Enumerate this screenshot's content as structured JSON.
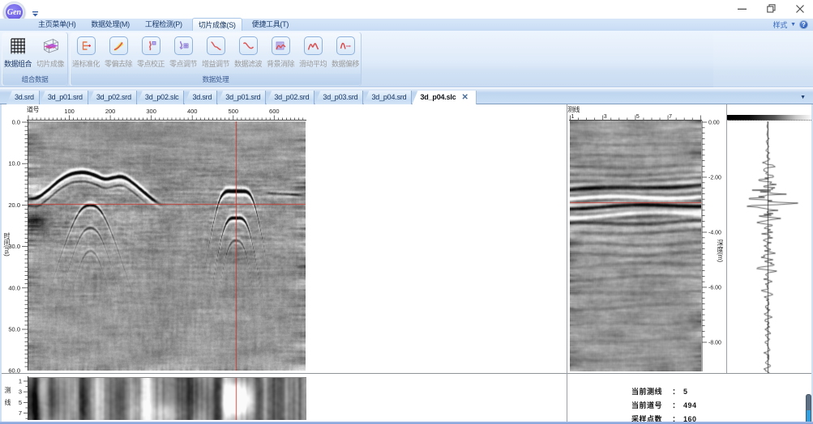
{
  "titlebar": {
    "logo_text": "Gen"
  },
  "window_buttons": {
    "minimize": "minimize",
    "restore": "restore-down",
    "close": "close"
  },
  "menu_tabs": {
    "active_index": 3,
    "items": [
      {
        "label": "主页菜单(H)"
      },
      {
        "label": "数据处理(M)"
      },
      {
        "label": "工程检测(P)"
      },
      {
        "label": "切片成像(S)"
      },
      {
        "label": "便捷工具(T)"
      }
    ]
  },
  "style_selector": {
    "label": "样式",
    "caret": "▼",
    "help_glyph": "?"
  },
  "ribbon": {
    "groups": [
      {
        "label": "组合数据",
        "buttons": [
          {
            "label": "数据组合",
            "icon": "data-combine-grid-icon",
            "enabled": true
          },
          {
            "label": "切片成像",
            "icon": "slice-imaging-cube-icon",
            "enabled": false
          }
        ]
      },
      {
        "label": "数据处理",
        "buttons": [
          {
            "label": "道标准化",
            "icon": "trace-normalize-icon",
            "enabled": false
          },
          {
            "label": "零偏去除",
            "icon": "dc-offset-remove-icon",
            "enabled": false
          },
          {
            "label": "零点校正",
            "icon": "zero-point-correct-icon",
            "enabled": false
          },
          {
            "label": "零点调节",
            "icon": "zero-point-adjust-icon",
            "enabled": false
          },
          {
            "label": "增益调节",
            "icon": "gain-adjust-icon",
            "enabled": false
          },
          {
            "label": "数据滤波",
            "icon": "data-filter-icon",
            "enabled": false
          },
          {
            "label": "背景消除",
            "icon": "background-remove-icon",
            "enabled": false
          },
          {
            "label": "滑动平均",
            "icon": "moving-average-icon",
            "enabled": false
          },
          {
            "label": "数据偏移",
            "icon": "data-shift-icon",
            "enabled": false
          }
        ]
      }
    ]
  },
  "document_tabs": {
    "active_index": 9,
    "close_glyph": "✕",
    "caret": "▼",
    "items": [
      {
        "label": "3d.srd"
      },
      {
        "label": "3d_p01.srd"
      },
      {
        "label": "3d_p02.srd"
      },
      {
        "label": "3d_p02.slc"
      },
      {
        "label": "3d.srd"
      },
      {
        "label": "3d_p01.srd"
      },
      {
        "label": "3d_p02.srd"
      },
      {
        "label": "3d_p03.srd"
      },
      {
        "label": "3d_p04.srd"
      },
      {
        "label": "3d_p04.slc"
      }
    ]
  },
  "main_view": {
    "trace_ruler": {
      "title": "道号",
      "tick_labels": [
        100,
        200,
        300,
        400,
        500,
        600
      ]
    },
    "time_axis": {
      "title": "时间(ns)",
      "tick_labels": [
        "0.0",
        "10.0",
        "20.0",
        "30.0",
        "40.0",
        "50.0",
        "60.0"
      ]
    },
    "crosshair": {
      "trace": 494,
      "time_ns": 19.9,
      "color": "#c23428"
    }
  },
  "slice_view": {
    "line_axis": {
      "title": "测线",
      "tick_labels": [
        "1",
        "3",
        "5",
        "7"
      ]
    }
  },
  "cross_view": {
    "line_ruler": {
      "title": "测线",
      "tick_labels": [
        "1",
        "3",
        "5",
        "7"
      ]
    },
    "depth_axis": {
      "title": "深度(m)",
      "tick_labels": [
        "0.00",
        "-2.00",
        "-4.00",
        "-6.00",
        "-8.00"
      ]
    },
    "marker_depth_m": -2.97,
    "marker_color": "#c23428"
  },
  "status_panel": {
    "separator": "：",
    "items": [
      {
        "label": "当前测线",
        "value": "5"
      },
      {
        "label": "当前道号",
        "value": "494"
      },
      {
        "label": "采样点数",
        "value": "160"
      }
    ]
  }
}
